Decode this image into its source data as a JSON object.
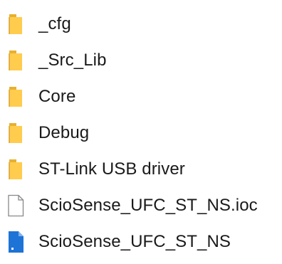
{
  "colors": {
    "folder_front": "#ffcc4d",
    "folder_back": "#e8b030",
    "text": "#1a1a1a",
    "file_outline": "#888888",
    "app_file": "#1e73d6"
  },
  "items": [
    {
      "name": "_cfg",
      "icon": "folder-icon"
    },
    {
      "name": "_Src_Lib",
      "icon": "folder-icon"
    },
    {
      "name": "Core",
      "icon": "folder-icon"
    },
    {
      "name": "Debug",
      "icon": "folder-icon"
    },
    {
      "name": "ST-Link USB driver",
      "icon": "folder-icon"
    },
    {
      "name": "ScioSense_UFC_ST_NS.ioc",
      "icon": "blank-file-icon"
    },
    {
      "name": "ScioSense_UFC_ST_NS",
      "icon": "app-file-icon"
    }
  ]
}
